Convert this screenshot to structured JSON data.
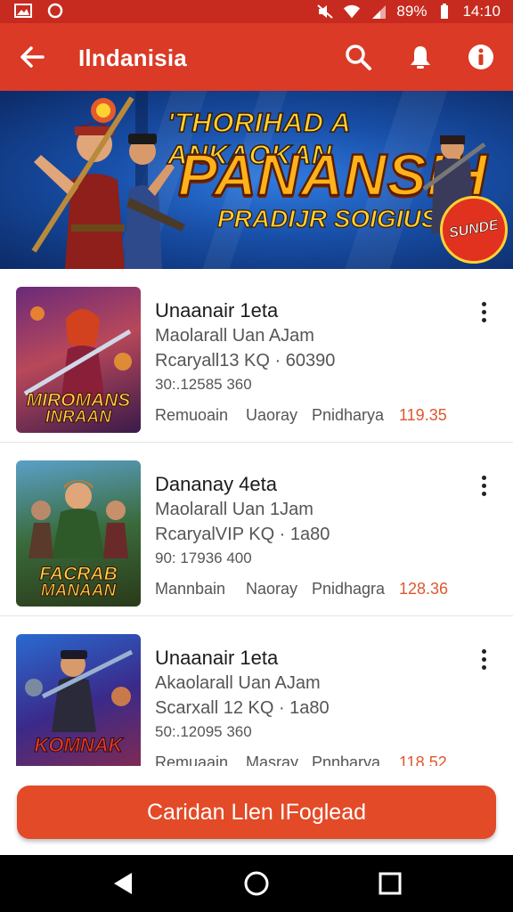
{
  "status_bar": {
    "battery_percent": "89%",
    "time": "14:10",
    "icons": [
      "image-icon",
      "circle-notification-icon",
      "mute-icon",
      "wifi-icon",
      "signal-icon",
      "battery-icon"
    ]
  },
  "app_bar": {
    "title": "Ilndanisia",
    "back_icon": "arrow-left-icon",
    "actions": [
      "search-icon",
      "bell-icon",
      "info-icon"
    ],
    "color": "#db3a26"
  },
  "banner": {
    "line1": "'THORIHAD A ANKAOKAN",
    "line2": "PANANSIH",
    "line3": "PRADIJR SOIGIUS",
    "badge": "SUNDE"
  },
  "items": [
    {
      "title": "Unaanair 1eta",
      "line2": "Maolarall Uan AJam",
      "line3": "Rcaryall13 KQ · 60390",
      "line4": "30:.12585 360",
      "meta1": "Remuoain",
      "meta2": "Uaoray",
      "meta3": "Pnidharya",
      "price": "119.35",
      "thumb_caption1": "MIROMANS",
      "thumb_caption2": "INRAAN"
    },
    {
      "title": "Dananay 4eta",
      "line2": "Maolarall Uan 1Jam",
      "line3": "RcaryalVIP KQ · 1a80",
      "line4": "90: 17936 400",
      "meta1": "Mannbain",
      "meta2": "Naoray",
      "meta3": "Pnidhagra",
      "price": "128.36",
      "thumb_caption1": "FACRAB",
      "thumb_caption2": "MANAAN"
    },
    {
      "title": "Unaanair 1eta",
      "line2": "Akaolarall Uan AJam",
      "line3": "Scarxall 12 KQ · 1a80",
      "line4": "50:.12095 360",
      "meta1": "Remuaain",
      "meta2": "Masray",
      "meta3": "Pnnbarya",
      "price": "118.52",
      "thumb_caption1": "KOMNAK",
      "thumb_caption2": ""
    }
  ],
  "cta": {
    "label": "Caridan Llen IFoglead",
    "color": "#e34a27"
  },
  "nav_bar": {
    "icons": [
      "back-triangle-icon",
      "home-circle-icon",
      "recents-square-icon"
    ]
  }
}
